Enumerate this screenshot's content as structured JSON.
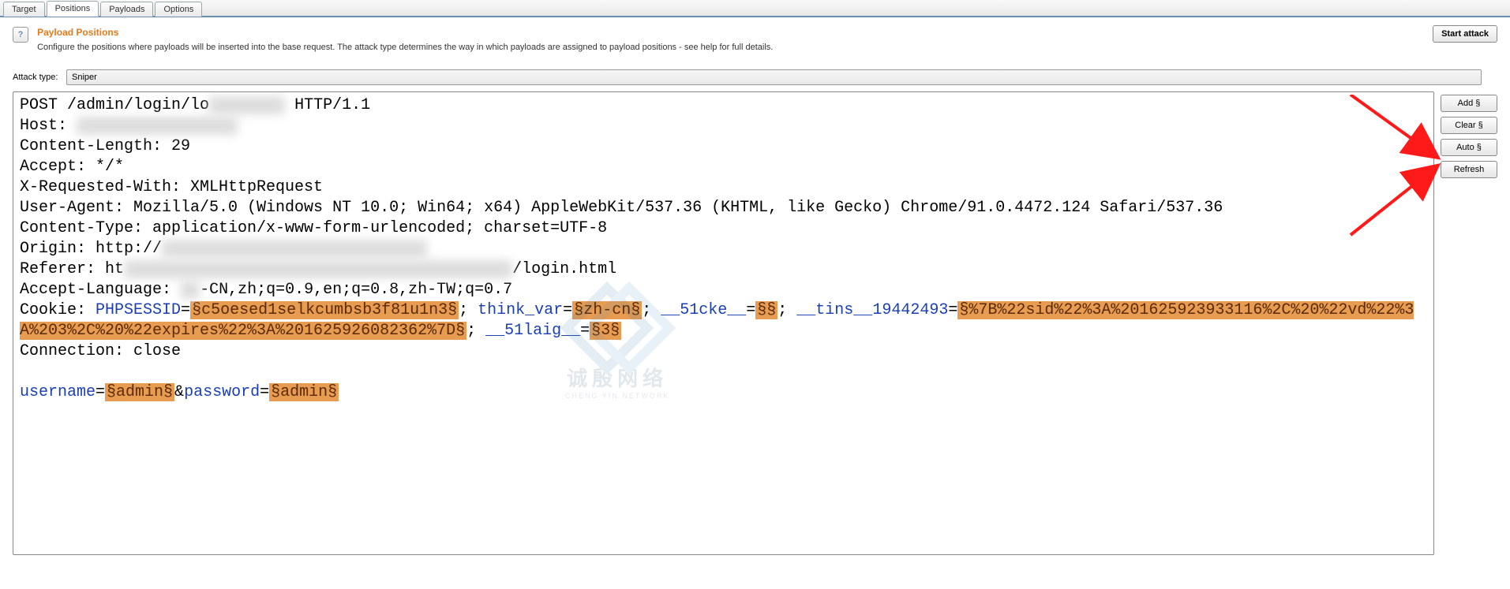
{
  "tabs": [
    "Target",
    "Positions",
    "Payloads",
    "Options"
  ],
  "active_tab": "Positions",
  "section": {
    "title": "Payload Positions",
    "description": "Configure the positions where payloads will be inserted into the base request. The attack type determines the way in which payloads are assigned to payload positions - see help for full details."
  },
  "start_attack_label": "Start attack",
  "attack_type": {
    "label": "Attack type:",
    "value": "Sniper"
  },
  "side_buttons": {
    "add": "Add §",
    "clear": "Clear §",
    "auto": "Auto §",
    "refresh": "Refresh"
  },
  "request": {
    "line1_a": "POST /admin/login/lo",
    "line1_blur": "gin.html",
    "line1_b": " HTTP/1.1",
    "host_label": "Host: ",
    "host_blur": "xxxxxxxxxxxxxxxxx",
    "content_length": "Content-Length: 29",
    "accept": "Accept: */*",
    "xrw": "X-Requested-With: XMLHttpRequest",
    "ua": "User-Agent: Mozilla/5.0 (Windows NT 10.0; Win64; x64) AppleWebKit/537.36 (KHTML, like Gecko) Chrome/91.0.4472.124 Safari/537.36",
    "ctype": "Content-Type: application/x-www-form-urlencoded; charset=UTF-8",
    "origin_a": "Origin: http://",
    "origin_blur": "xxxxxxxxxxxxxxxxxxxxxxxxxxxx",
    "referer_a": "Referer: ht",
    "referer_blur": "tp://xxxxxxxxxxxxxxxxxxxxxxxxxxxxxxxxxxxx",
    "referer_b": "/login.html",
    "alang_a": "Accept-Language: ",
    "alang_blur": "zh",
    "alang_b": "-CN,zh;q=0.9,en;q=0.8,zh-TW;q=0.7",
    "cookie_label": "Cookie: ",
    "phpsessid_key": "PHPSESSID",
    "phpsessid_val": "§c5oesed1selkcumbsb3f81u1n3§",
    "thinkvar_key": "think_var",
    "thinkvar_val": "§zh-cn§",
    "cke_key": "__51cke__",
    "cke_val": "§§",
    "tins_key": "__tins__19442493",
    "tins_val": "§%7B%22sid%22%3A%201625923933116%2C%20%22vd%22%3A%203%2C%20%22expires%22%3A%201625926082362%7D§",
    "laig_key": "__51laig__",
    "laig_val": "§3§",
    "connection": "Connection: close",
    "body_user_key": "username",
    "body_user_val": "§admin§",
    "body_pass_key": "password",
    "body_pass_val": "§admin§",
    "amp": "&",
    "eq": "=",
    "semi": "; "
  },
  "watermark": {
    "line1": "诚殷网络",
    "line2": "CHENG YIN NETWORK"
  }
}
